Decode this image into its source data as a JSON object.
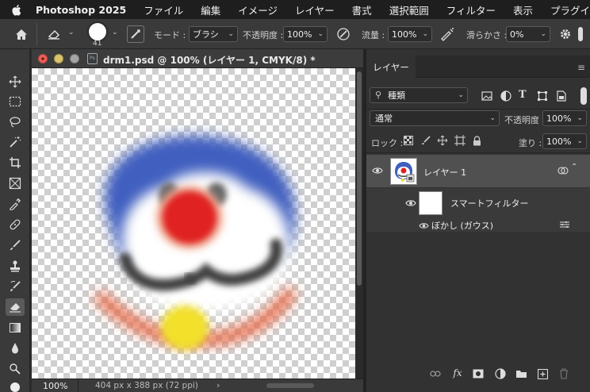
{
  "menubar": {
    "app_name": "Photoshop 2025",
    "items": [
      "ファイル",
      "編集",
      "イメージ",
      "レイヤー",
      "書式",
      "選択範囲",
      "フィルター",
      "表示",
      "プラグイン"
    ]
  },
  "options": {
    "brush_size": "41",
    "mode_label": "モード :",
    "mode_value": "ブラシ",
    "opacity_label": "不透明度 :",
    "opacity_value": "100%",
    "flow_label": "流量 :",
    "flow_value": "100%",
    "smoothing_label": "滑らかさ :",
    "smoothing_value": "0%"
  },
  "document": {
    "title": "drm1.psd @ 100% (レイヤー 1, CMYK/8) *",
    "zoom": "100%",
    "info": "404 px x 388 px (72 ppi)"
  },
  "layers_panel": {
    "tab_label": "レイヤー",
    "filter_kind": "種類",
    "blend_mode": "通常",
    "opacity_label": "不透明度 :",
    "opacity_value": "100%",
    "lock_label": "ロック :",
    "fill_label": "塗り :",
    "fill_value": "100%",
    "layers": [
      {
        "name": "レイヤー 1"
      },
      {
        "name": "スマートフィルター"
      },
      {
        "name": "ぼかし (ガウス)"
      }
    ]
  },
  "colors": {
    "menubar_bg": "#1e1e1e",
    "panel_bg": "#323232",
    "selected_layer_bg": "#505050",
    "face_blue": "#3f5fbf",
    "nose_red": "#e02020",
    "bell_yellow": "#f2e02a"
  }
}
